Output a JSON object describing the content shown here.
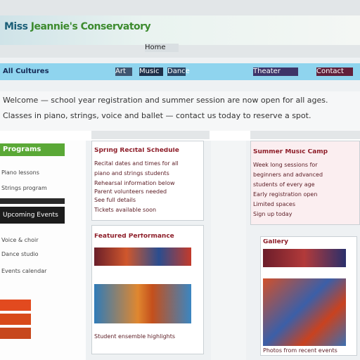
{
  "header": {
    "title_part1": "Miss",
    "title_part2": "Jeannie's Conservatory",
    "subtitle_link": "Home"
  },
  "nav": {
    "brand": "All Cultures",
    "items": [
      "Art",
      "Music",
      "Dance",
      "Theater",
      "Contact"
    ]
  },
  "announcement": {
    "line1": "Welcome — school year registration and summer session are now open for all ages.",
    "line2": "Classes in piano, strings, voice and ballet — contact us today to reserve a spot."
  },
  "sidebar": {
    "header": "Programs",
    "items": [
      "Piano lessons",
      "Strings program",
      "Voice & choir",
      "Dance studio",
      "Events calendar"
    ],
    "dark_label": "Upcoming Events"
  },
  "cards": {
    "card1": {
      "title": "Spring Recital Schedule",
      "lines": [
        "Recital dates and times for all",
        "piano and strings students",
        "Rehearsal information below",
        "Parent volunteers needed",
        "See full details",
        "Tickets available soon"
      ]
    },
    "card2": {
      "title": "Summer Music Camp",
      "lines": [
        "Week long sessions for",
        "beginners and advanced",
        "students of every age",
        "Early registration open",
        "Limited spaces",
        "Sign up today"
      ]
    },
    "card3": {
      "title": "Featured Performance",
      "caption": "Student ensemble highlights"
    },
    "card4": {
      "title": "Gallery",
      "caption": "Photos from recent events"
    }
  },
  "colors": {
    "nav_bg": "#8fd4ee",
    "title_blue": "#1b5f78",
    "title_green": "#3d8b2f",
    "sidebar_header": "#5aa836",
    "card_title": "#8e1f2a"
  }
}
